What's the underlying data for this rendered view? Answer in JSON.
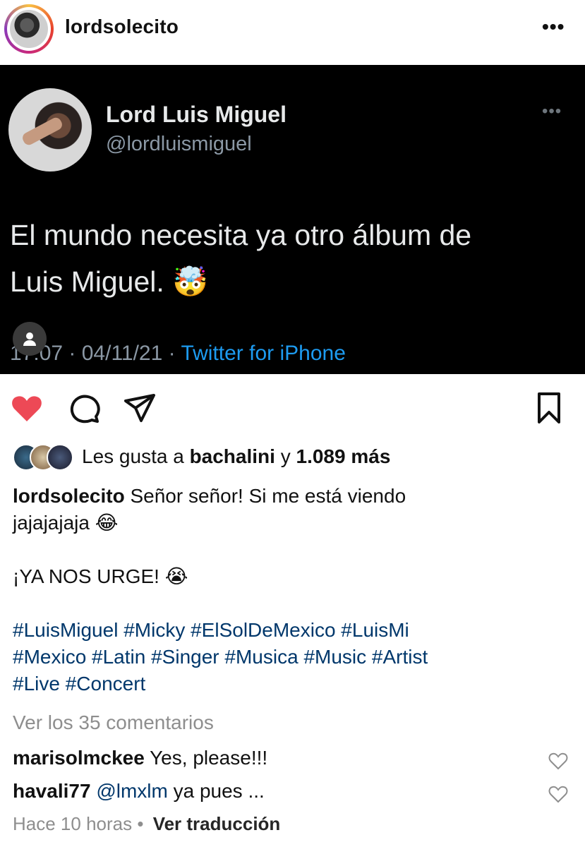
{
  "header": {
    "username": "lordsolecito",
    "more": "•••"
  },
  "tweet": {
    "name": "Lord Luis Miguel",
    "handle": "@lordluismiguel",
    "more": "•••",
    "text_line1": "El mundo necesita ya otro álbum de",
    "text_line2": "Luis Miguel.",
    "emoji": "🤯",
    "time": "17:07",
    "date": "04/11/21",
    "source": "Twitter for iPhone"
  },
  "likes": {
    "prefix": "Les gusta a",
    "user": "bachalini",
    "conj": "y",
    "count": "1.089 más"
  },
  "caption": {
    "username": "lordsolecito",
    "line1": "Señor señor! Si me está viendo",
    "line2": "jajajajaja 😂",
    "line3": "¡YA NOS URGE! 😭",
    "hashtags_1": "#LuisMiguel #Micky #ElSolDeMexico #LuisMi",
    "hashtags_2": "#Mexico #Latin #Singer #Musica #Music #Artist",
    "hashtags_3": "#Live #Concert"
  },
  "view_comments": "Ver los 35 comentarios",
  "comments": [
    {
      "user": "marisolmckee",
      "text": "Yes, please!!!"
    },
    {
      "user": "havali77",
      "mention": "@lmxlm",
      "text": "ya pues ..."
    }
  ],
  "footer": {
    "time": "Hace 10 horas",
    "dot": "•",
    "translate": "Ver traducción"
  },
  "colors": {
    "like_red": "#ed4956",
    "link_blue": "#00376b",
    "twitter_blue": "#1d9bf0"
  }
}
